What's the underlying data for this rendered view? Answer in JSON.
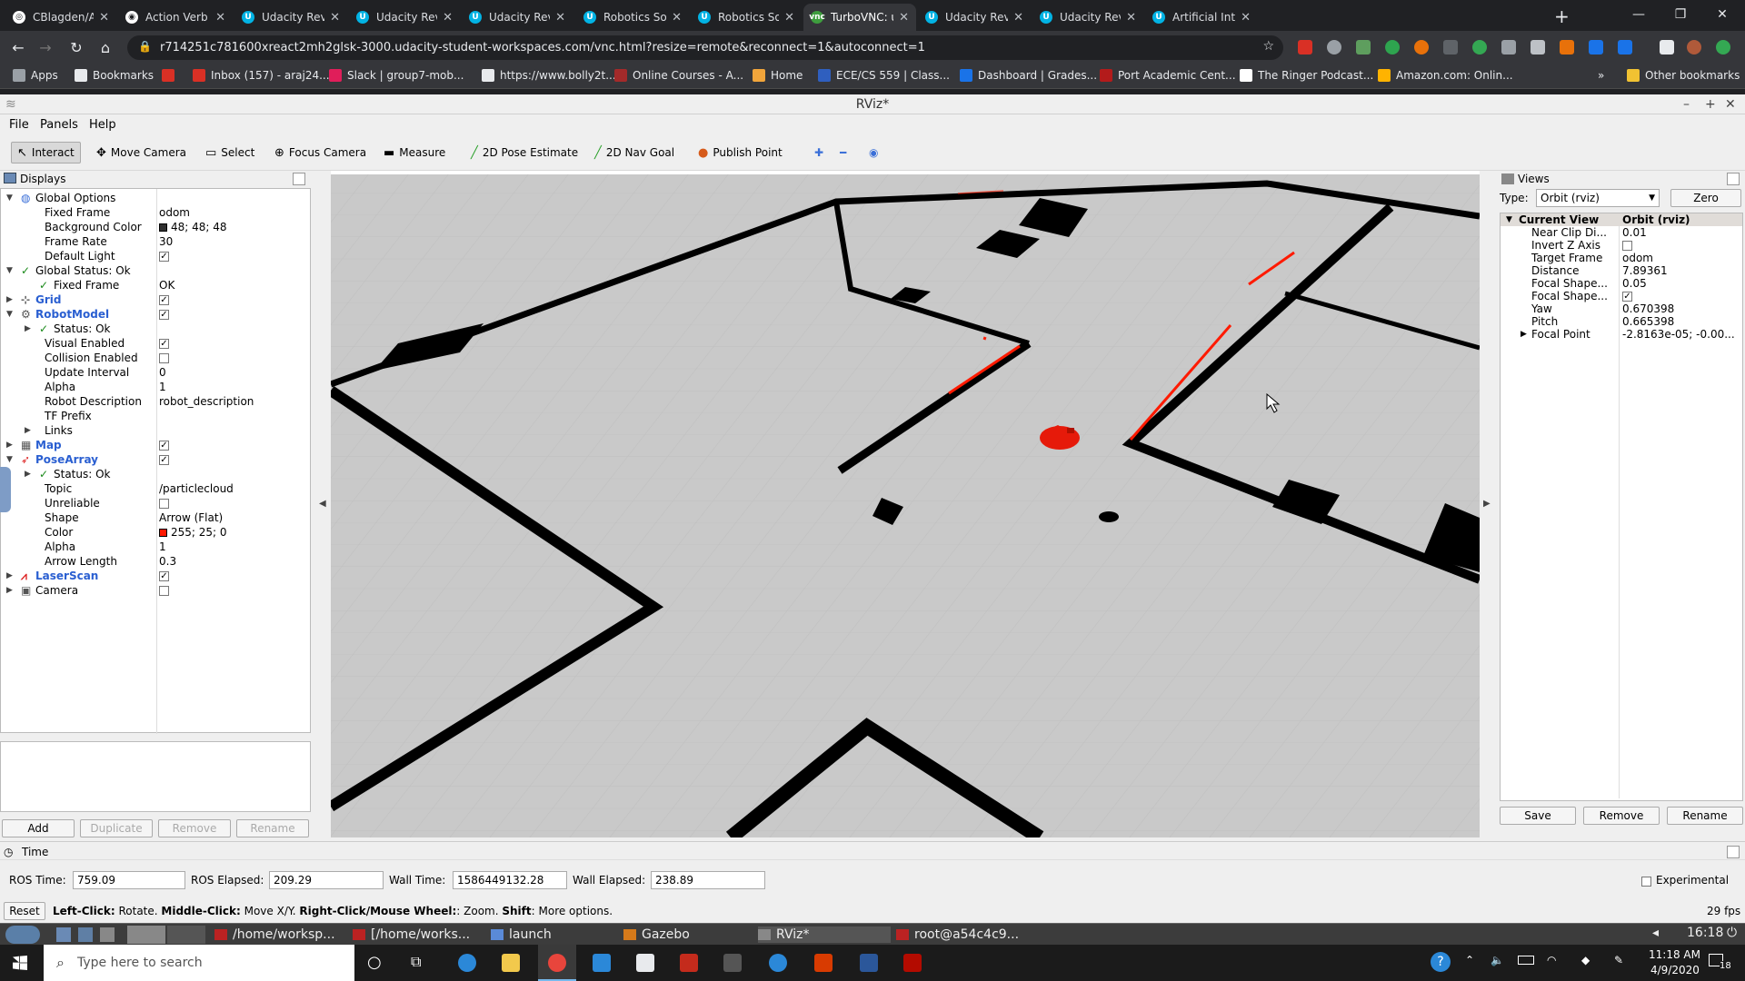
{
  "browser": {
    "tabs": [
      {
        "title": "CBlagden/AI-for",
        "fav": "#ffffff",
        "favtext": "◎"
      },
      {
        "title": "Action Verb List",
        "fav": "#ffffff",
        "favtext": "◉"
      },
      {
        "title": "Udacity Reviews",
        "fav": "#02b3e4",
        "favtext": "U"
      },
      {
        "title": "Udacity Reviews",
        "fav": "#02b3e4",
        "favtext": "U"
      },
      {
        "title": "Udacity Reviews",
        "fav": "#02b3e4",
        "favtext": "U"
      },
      {
        "title": "Robotics Softwa",
        "fav": "#02b3e4",
        "favtext": "U"
      },
      {
        "title": "Robotics Softwa",
        "fav": "#02b3e4",
        "favtext": "U"
      },
      {
        "title": "TurboVNC: unix",
        "fav": "#3e9e3e",
        "favtext": "vnc"
      },
      {
        "title": "Udacity Reviews",
        "fav": "#02b3e4",
        "favtext": "U"
      },
      {
        "title": "Udacity Reviews",
        "fav": "#02b3e4",
        "favtext": "U"
      },
      {
        "title": "Artificial Intellige",
        "fav": "#02b3e4",
        "favtext": "U"
      }
    ],
    "url": "r714251c781600xreact2mh2glsk-3000.udacity-student-workspaces.com/vnc.html?resize=remote&reconnect=1&autoconnect=1",
    "bookmarks": [
      {
        "label": "Apps",
        "color": "#9aa0a6"
      },
      {
        "label": "Bookmarks",
        "color": "#e8eaed"
      },
      {
        "label": "",
        "color": "#d93025"
      },
      {
        "label": "Inbox (157) - araj24...",
        "color": "#d93025"
      },
      {
        "label": "Slack | group7-mob...",
        "color": "#e01e5a"
      },
      {
        "label": "https://www.bolly2t...",
        "color": "#e8eaed"
      },
      {
        "label": "Online Courses - A...",
        "color": "#a42a2a"
      },
      {
        "label": "Home",
        "color": "#f1a53b"
      },
      {
        "label": "ECE/CS 559 | Class...",
        "color": "#2f5fbf"
      },
      {
        "label": "Dashboard | Grades...",
        "color": "#1a73e8"
      },
      {
        "label": "Port Academic Cent...",
        "color": "#b31b1b"
      },
      {
        "label": "The Ringer Podcast...",
        "color": "#ffffff"
      },
      {
        "label": "Amazon.com: Onlin...",
        "color": "#ffb300"
      }
    ],
    "other_bookmarks": "Other bookmarks",
    "more": "»"
  },
  "rviz": {
    "title": "RViz*",
    "menus": [
      "File",
      "Panels",
      "Help"
    ],
    "tools": [
      {
        "label": "Interact",
        "icon": "↖",
        "active": true
      },
      {
        "label": "Move Camera",
        "icon": "✥",
        "active": false
      },
      {
        "label": "Select",
        "icon": "▭",
        "active": false
      },
      {
        "label": "Focus Camera",
        "icon": "⊕",
        "active": false
      },
      {
        "label": "Measure",
        "icon": "▬",
        "active": false
      },
      {
        "label": "2D Pose Estimate",
        "icon": "╱",
        "active": false
      },
      {
        "label": "2D Nav Goal",
        "icon": "╱",
        "active": false
      },
      {
        "label": "Publish Point",
        "icon": "●",
        "active": false
      }
    ],
    "displays": {
      "title": "Displays",
      "rows": [
        {
          "indent": 0,
          "arrow": "down",
          "icon": "globe-icon",
          "label": "Global Options",
          "value": "",
          "style": ""
        },
        {
          "indent": 1,
          "arrow": "",
          "icon": "",
          "label": "Fixed Frame",
          "value": "odom",
          "style": ""
        },
        {
          "indent": 1,
          "arrow": "",
          "icon": "",
          "label": "Background Color",
          "value": "48; 48; 48",
          "swatch": "#303030",
          "style": ""
        },
        {
          "indent": 1,
          "arrow": "",
          "icon": "",
          "label": "Frame Rate",
          "value": "30",
          "style": ""
        },
        {
          "indent": 1,
          "arrow": "",
          "icon": "",
          "label": "Default Light",
          "check": true,
          "value": "",
          "style": ""
        },
        {
          "indent": 0,
          "arrow": "down",
          "icon": "check-icon",
          "label": "Global Status: Ok",
          "value": "",
          "style": ""
        },
        {
          "indent": 1,
          "arrow": "",
          "icon": "check-icon",
          "label": "Fixed Frame",
          "value": "OK",
          "style": ""
        },
        {
          "indent": 0,
          "arrow": "right",
          "icon": "grid-icon",
          "label": "Grid",
          "check": true,
          "value": "",
          "style": "blue"
        },
        {
          "indent": 0,
          "arrow": "down",
          "icon": "robot-icon",
          "label": "RobotModel",
          "check": true,
          "value": "",
          "style": "blue"
        },
        {
          "indent": 1,
          "arrow": "right",
          "icon": "check-icon",
          "label": "Status: Ok",
          "value": "",
          "style": ""
        },
        {
          "indent": 1,
          "arrow": "",
          "icon": "",
          "label": "Visual Enabled",
          "check": true,
          "value": "",
          "style": ""
        },
        {
          "indent": 1,
          "arrow": "",
          "icon": "",
          "label": "Collision Enabled",
          "check": false,
          "value": "",
          "style": ""
        },
        {
          "indent": 1,
          "arrow": "",
          "icon": "",
          "label": "Update Interval",
          "value": "0",
          "style": ""
        },
        {
          "indent": 1,
          "arrow": "",
          "icon": "",
          "label": "Alpha",
          "value": "1",
          "style": ""
        },
        {
          "indent": 1,
          "arrow": "",
          "icon": "",
          "label": "Robot Description",
          "value": "robot_description",
          "style": ""
        },
        {
          "indent": 1,
          "arrow": "",
          "icon": "",
          "label": "TF Prefix",
          "value": "",
          "style": ""
        },
        {
          "indent": 1,
          "arrow": "right",
          "icon": "",
          "label": "Links",
          "value": "",
          "style": ""
        },
        {
          "indent": 0,
          "arrow": "right",
          "icon": "map-icon",
          "label": "Map",
          "check": true,
          "value": "",
          "style": "blue"
        },
        {
          "indent": 0,
          "arrow": "down",
          "icon": "posearray-icon",
          "label": "PoseArray",
          "check": true,
          "value": "",
          "style": "blue"
        },
        {
          "indent": 1,
          "arrow": "right",
          "icon": "check-icon",
          "label": "Status: Ok",
          "value": "",
          "style": ""
        },
        {
          "indent": 1,
          "arrow": "",
          "icon": "",
          "label": "Topic",
          "value": "/particlecloud",
          "style": ""
        },
        {
          "indent": 1,
          "arrow": "",
          "icon": "",
          "label": "Unreliable",
          "check": false,
          "value": "",
          "style": ""
        },
        {
          "indent": 1,
          "arrow": "",
          "icon": "",
          "label": "Shape",
          "value": "Arrow (Flat)",
          "style": ""
        },
        {
          "indent": 1,
          "arrow": "",
          "icon": "",
          "label": "Color",
          "value": "255; 25; 0",
          "swatch": "#ff1900",
          "style": ""
        },
        {
          "indent": 1,
          "arrow": "",
          "icon": "",
          "label": "Alpha",
          "value": "1",
          "style": ""
        },
        {
          "indent": 1,
          "arrow": "",
          "icon": "",
          "label": "Arrow Length",
          "value": "0.3",
          "style": ""
        },
        {
          "indent": 0,
          "arrow": "right",
          "icon": "laserscan-icon",
          "label": "LaserScan",
          "check": true,
          "value": "",
          "style": "blue"
        },
        {
          "indent": 0,
          "arrow": "right",
          "icon": "camera-icon",
          "label": "Camera",
          "check": false,
          "value": "",
          "style": ""
        }
      ],
      "buttons": {
        "add": "Add",
        "duplicate": "Duplicate",
        "remove": "Remove",
        "rename": "Rename"
      }
    },
    "views": {
      "title": "Views",
      "type_label": "Type:",
      "type_value": "Orbit (rviz)",
      "zero": "Zero",
      "header_key": "Current View",
      "header_val": "Orbit (rviz)",
      "rows": [
        {
          "label": "Near Clip Di...",
          "value": "0.01"
        },
        {
          "label": "Invert Z Axis",
          "check": false,
          "value": ""
        },
        {
          "label": "Target Frame",
          "value": "odom"
        },
        {
          "label": "Distance",
          "value": "7.89361"
        },
        {
          "label": "Focal Shape...",
          "value": "0.05"
        },
        {
          "label": "Focal Shape...",
          "check": true,
          "value": ""
        },
        {
          "label": "Yaw",
          "value": "0.670398"
        },
        {
          "label": "Pitch",
          "value": "0.665398"
        },
        {
          "label": "Focal Point",
          "value": "-2.8163e-05; -0.00...",
          "arrow": true
        }
      ],
      "buttons": {
        "save": "Save",
        "remove": "Remove",
        "rename": "Rename"
      }
    },
    "time": {
      "title": "Time",
      "ros_time_label": "ROS Time:",
      "ros_time": "759.09",
      "ros_elapsed_label": "ROS Elapsed:",
      "ros_elapsed": "209.29",
      "wall_time_label": "Wall Time:",
      "wall_time": "1586449132.28",
      "wall_elapsed_label": "Wall Elapsed:",
      "wall_elapsed": "238.89",
      "experimental": "Experimental"
    },
    "status": {
      "reset": "Reset",
      "hint_b1": "Left-Click:",
      "hint_1": " Rotate. ",
      "hint_b2": "Middle-Click:",
      "hint_2": " Move X/Y. ",
      "hint_b3": "Right-Click/Mouse Wheel:",
      "hint_3": ": Zoom. ",
      "hint_b4": "Shift",
      "hint_4": ": More options.",
      "fps": "29 fps"
    }
  },
  "vnc_taskbar": {
    "items": [
      "/home/worksp...",
      "[/home/works...",
      "launch",
      "Gazebo",
      "RViz*",
      "root@a54c4c9..."
    ],
    "clock": "16:18"
  },
  "windows": {
    "search": "Type here to search",
    "time": "11:18 AM",
    "date": "4/9/2020",
    "notif": "18"
  }
}
